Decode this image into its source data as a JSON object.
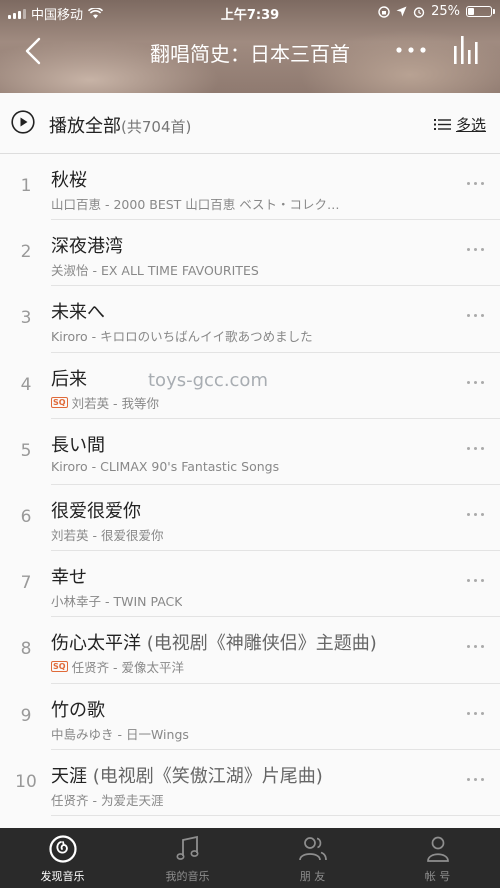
{
  "status": {
    "carrier": "中国移动",
    "time": "上午7:39",
    "battery": "25%"
  },
  "nav": {
    "title": "翻唱简史：日本三百首"
  },
  "playall": {
    "label": "播放全部",
    "count": "(共704首)",
    "multi": "多选"
  },
  "watermark": "toys-gcc.com",
  "songs": [
    {
      "num": "1",
      "title": "秋桜",
      "subtitle": "",
      "sq": false,
      "meta": "山口百恵 - 2000 BEST 山口百恵 ベスト・コレク…"
    },
    {
      "num": "2",
      "title": "深夜港湾",
      "subtitle": "",
      "sq": false,
      "meta": "关淑怡 - EX ALL TIME FAVOURITES"
    },
    {
      "num": "3",
      "title": "未来へ",
      "subtitle": "",
      "sq": false,
      "meta": "Kiroro - キロロのいちばんイイ歌あつめました"
    },
    {
      "num": "4",
      "title": "后来",
      "subtitle": "",
      "sq": true,
      "meta": "刘若英 - 我等你"
    },
    {
      "num": "5",
      "title": "長い間",
      "subtitle": "",
      "sq": false,
      "meta": "Kiroro - CLIMAX 90's Fantastic Songs"
    },
    {
      "num": "6",
      "title": "很爱很爱你",
      "subtitle": "",
      "sq": false,
      "meta": "刘若英 - 很爱很爱你"
    },
    {
      "num": "7",
      "title": "幸せ",
      "subtitle": "",
      "sq": false,
      "meta": "小林幸子 - TWIN PACK"
    },
    {
      "num": "8",
      "title": "伤心太平洋",
      "subtitle": " (电视剧《神雕侠侣》主题曲)",
      "sq": true,
      "meta": "任贤齐 - 爱像太平洋"
    },
    {
      "num": "9",
      "title": "竹の歌",
      "subtitle": "",
      "sq": false,
      "meta": "中島みゆき - 日一Wings"
    },
    {
      "num": "10",
      "title": "天涯",
      "subtitle": " (电视剧《笑傲江湖》片尾曲)",
      "sq": false,
      "meta": "任贤齐 - 为爱走天涯"
    }
  ],
  "sq_badge": "SQ",
  "tabs": [
    {
      "label": "发现音乐",
      "icon": "netease-music-icon",
      "active": true
    },
    {
      "label": "我的音乐",
      "icon": "music-note-icon",
      "active": false
    },
    {
      "label": "朋 友",
      "icon": "friends-icon",
      "active": false
    },
    {
      "label": "帐 号",
      "icon": "account-icon",
      "active": false
    }
  ],
  "colors": {
    "accent": "#e06a39",
    "tabbar": "#2a2a2a"
  }
}
